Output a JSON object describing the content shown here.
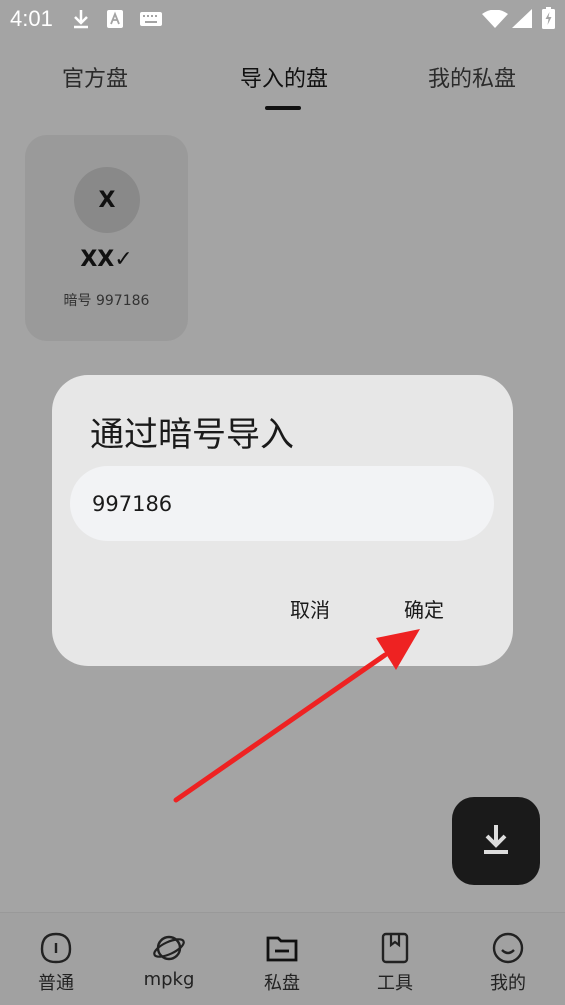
{
  "status_bar": {
    "time": "4:01"
  },
  "tabs": [
    {
      "label": "官方盘"
    },
    {
      "label": "导入的盘"
    },
    {
      "label": "我的私盘"
    }
  ],
  "card": {
    "avatar_letter": "X",
    "name": "XX✓",
    "code": "暗号 997186"
  },
  "dialog": {
    "title": "通过暗号导入",
    "input_value": "997186",
    "cancel_label": "取消",
    "confirm_label": "确定"
  },
  "bottom_nav": [
    {
      "label": "普通",
      "icon": "info-icon"
    },
    {
      "label": "mpkg",
      "icon": "planet-icon"
    },
    {
      "label": "私盘",
      "icon": "folder-icon"
    },
    {
      "label": "工具",
      "icon": "book-icon"
    },
    {
      "label": "我的",
      "icon": "smile-icon"
    }
  ],
  "colors": {
    "annotation_arrow": "#ee2222",
    "fab_bg": "#1a1a1a"
  }
}
